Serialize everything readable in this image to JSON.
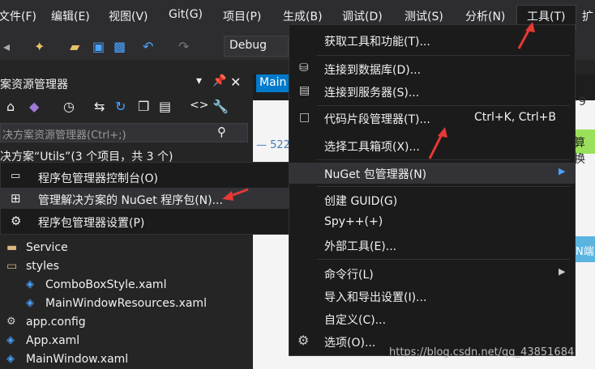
{
  "menubar": {
    "items": [
      "文件(F)",
      "编辑(E)",
      "视图(V)",
      "Git(G)",
      "项目(P)",
      "生成(B)",
      "调试(D)",
      "测试(S)",
      "分析(N)",
      "工具(T)",
      "扩"
    ]
  },
  "toolbar": {
    "config": "Debug"
  },
  "solution_explorer": {
    "title": "案资源管理器",
    "search_placeholder": "决方案资源管理器(Ctrl+;)",
    "solution_label": "决方案“Utils”(3 个项目，共 3 个)",
    "tree": [
      "Service",
      "styles",
      "ComboBoxStyle.xaml",
      "MainWindowResources.xaml",
      "app.config",
      "App.xaml",
      "MainWindow.xaml"
    ]
  },
  "editor": {
    "tab": "Main",
    "line_number": "522",
    "right_text_1": "算换",
    "right_text_2": "N端",
    "right_char": "9"
  },
  "nuget_submenu": {
    "items": [
      "程序包管理器控制台(O)",
      "管理解决方案的 NuGet 程序包(N)...",
      "程序包管理器设置(P)"
    ]
  },
  "tools_menu": {
    "items": [
      {
        "label": "获取工具和功能(T)...",
        "shortcut": ""
      },
      {
        "label": "连接到数据库(D)...",
        "shortcut": ""
      },
      {
        "label": "连接到服务器(S)...",
        "shortcut": ""
      },
      {
        "label": "代码片段管理器(T)...",
        "shortcut": "Ctrl+K, Ctrl+B"
      },
      {
        "label": "选择工具箱项(X)...",
        "shortcut": ""
      },
      {
        "label": "NuGet 包管理器(N)",
        "shortcut": ""
      },
      {
        "label": "创建 GUID(G)",
        "shortcut": ""
      },
      {
        "label": "Spy++(+)",
        "shortcut": ""
      },
      {
        "label": "外部工具(E)...",
        "shortcut": ""
      },
      {
        "label": "命令行(L)",
        "shortcut": ""
      },
      {
        "label": "导入和导出设置(I)...",
        "shortcut": ""
      },
      {
        "label": "自定义(C)...",
        "shortcut": ""
      },
      {
        "label": "选项(O)...",
        "shortcut": ""
      }
    ]
  },
  "watermark": "https://blog.csdn.net/qq_43851684"
}
